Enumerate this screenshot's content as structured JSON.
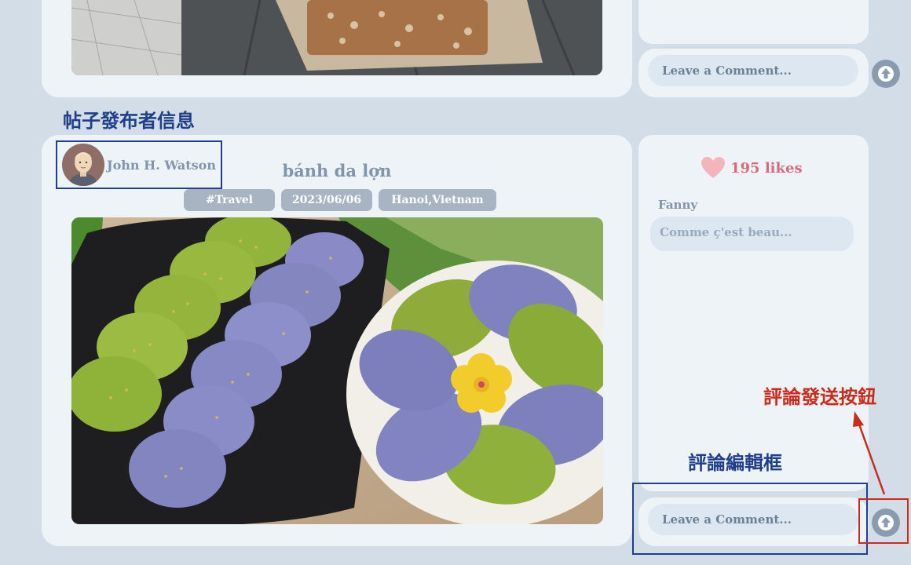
{
  "top_post": {
    "comment_placeholder": "Leave a Comment..."
  },
  "post": {
    "author_name": "John H. Watson",
    "title": "bánh da lợn",
    "tags": [
      "#Travel",
      "2023/06/06",
      "Hanoi,Vietnam"
    ]
  },
  "side_panel": {
    "likes": "195 likes",
    "comment": {
      "user": "Fanny",
      "text": "Comme ç'est beau..."
    },
    "comment_placeholder": "Leave a Comment..."
  },
  "annotations": {
    "poster_info": "帖子發布者信息",
    "comment_box": "評論編輯框",
    "send_button": "評論發送按鈕"
  },
  "colors": {
    "background": "#d3dde8",
    "card": "#eef3f8",
    "annotation_blue": "#1f3f8a",
    "annotation_red": "#cc2b1c",
    "likes": "#d96a78"
  }
}
